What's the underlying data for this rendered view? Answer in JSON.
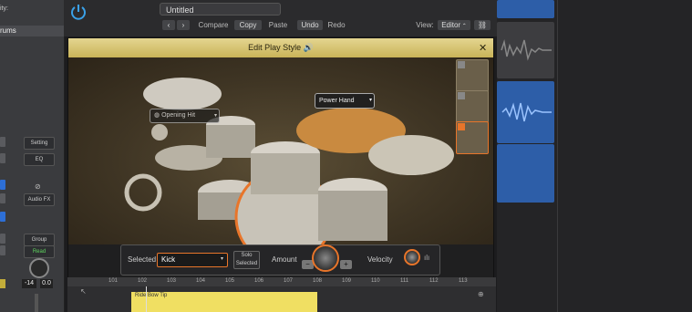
{
  "inspector": {
    "header_fragment": "ity:",
    "track_name": "rums",
    "setting_label": "Setting",
    "eq_label": "EQ",
    "audio_fx_label": "Audio FX",
    "group_label": "Group",
    "automation_mode": "Read",
    "volume_value": "-14",
    "pan_value": "0.0"
  },
  "toolbar": {
    "title": "Untitled",
    "compare_label": "Compare",
    "copy_label": "Copy",
    "paste_label": "Paste",
    "undo_label": "Undo",
    "redo_label": "Redo",
    "view_label": "View:",
    "view_value": "Editor"
  },
  "dialog": {
    "title": "Edit Play Style",
    "power_hand_label": "Power Hand",
    "opening_hit_label": "Opening Hit",
    "selected_label": "Selected",
    "selected_value": "Kick",
    "solo_selected_label": "Solo Selected",
    "amount_label": "Amount",
    "velocity_label": "Velocity",
    "minus_label": "−",
    "plus_label": "+"
  },
  "timeline": {
    "ruler_labels": [
      "101",
      "102",
      "103",
      "104",
      "105",
      "106",
      "107",
      "108",
      "109",
      "110",
      "111",
      "112",
      "113"
    ],
    "region_label": "Ride Bow Tip"
  },
  "colors": {
    "accent_orange": "#e8752a",
    "title_bar_gold": "#d9c77a",
    "region_blue": "#2d5ea8",
    "region_yellow": "#f0df62"
  }
}
